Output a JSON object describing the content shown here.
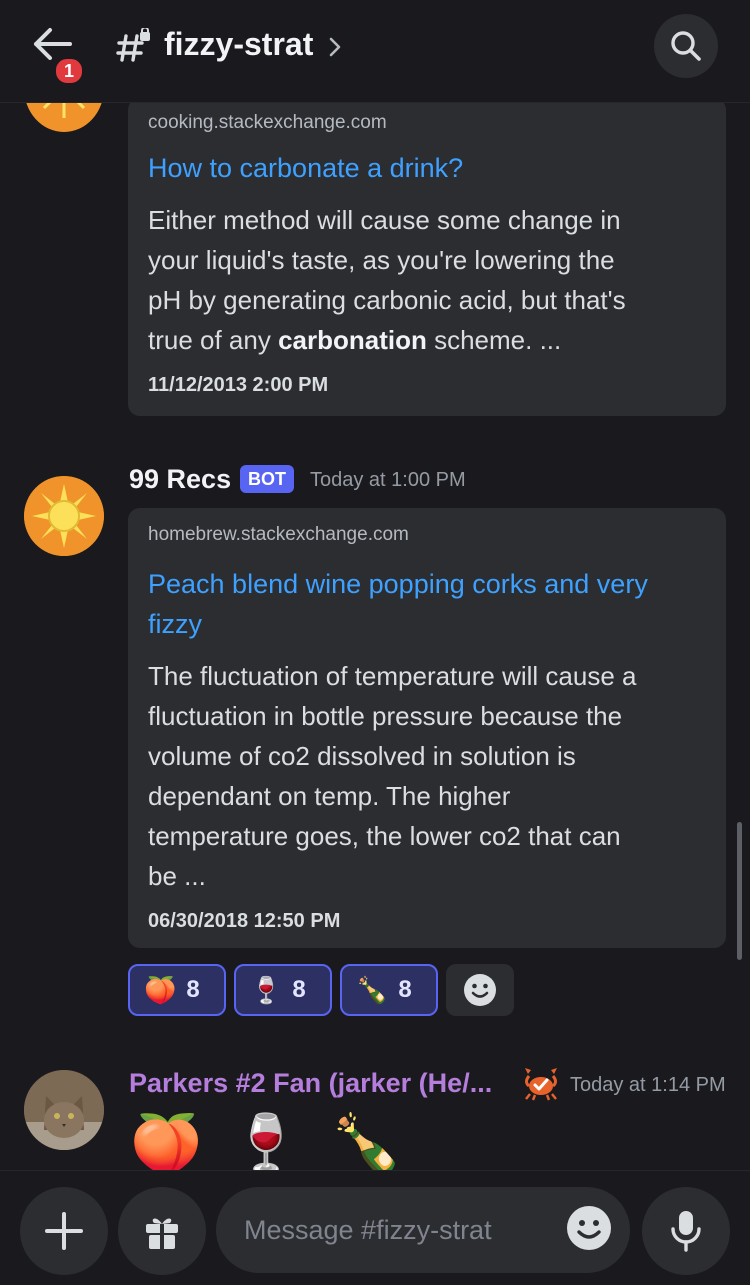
{
  "header": {
    "channel_name": "fizzy-strat",
    "notification_count": "1"
  },
  "messages": [
    {
      "embed": {
        "provider": "cooking.stackexchange.com",
        "title": "How to carbonate a drink?",
        "desc_lines": [
          "Either method will cause some change in",
          "your liquid's taste, as you're lowering the",
          "pH by generating carbonic acid, but that's"
        ],
        "desc_last_pre": "true of any ",
        "desc_last_bold": "carbonation",
        "desc_last_post": " scheme. ...",
        "date": "11/12/2013 2:00 PM"
      }
    },
    {
      "author": "99 Recs",
      "bot_tag": "BOT",
      "timestamp": "Today at 1:00 PM",
      "embed": {
        "provider": "homebrew.stackexchange.com",
        "title_lines": [
          "Peach blend wine popping corks and very",
          "fizzy"
        ],
        "desc_lines": [
          "The fluctuation of temperature will cause a",
          "fluctuation in bottle pressure because the",
          "volume of co2 dissolved in solution is",
          "dependant on temp. The higher",
          "temperature goes, the lower co2 that can",
          "be  ..."
        ],
        "date": "06/30/2018 12:50 PM"
      },
      "reactions": [
        {
          "emoji": "🍑",
          "count": "8"
        },
        {
          "emoji": "🍷",
          "count": "8"
        },
        {
          "emoji": "🍾",
          "count": "8"
        }
      ]
    },
    {
      "author": "Parkers #2 Fan (jarker (He/...",
      "author_color": "#b57edc",
      "timestamp": "Today at 1:14 PM",
      "content_emojis": [
        "🍑",
        "🍷",
        "🍾"
      ]
    }
  ],
  "composer": {
    "placeholder": "Message #fizzy-strat"
  },
  "colors": {
    "background": "#1a1a1e",
    "embed_bg": "#2b2d31",
    "link": "#3ea1ff",
    "bot_tag": "#5865f2",
    "badge": "#e03a3e"
  }
}
